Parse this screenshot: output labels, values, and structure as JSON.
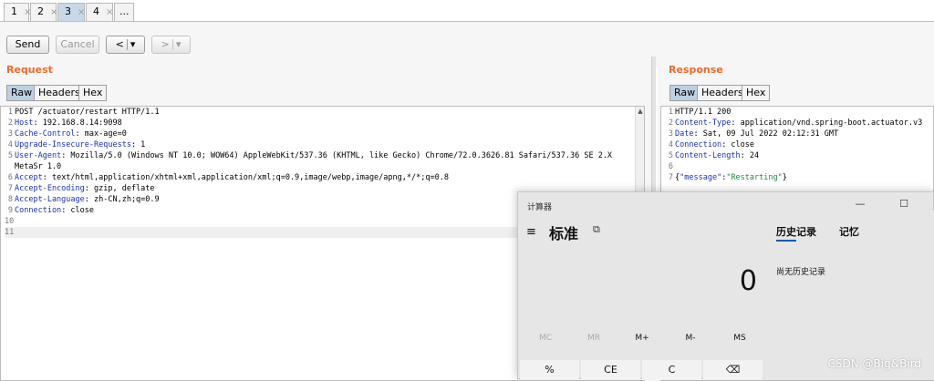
{
  "tabs": [
    {
      "label": "1",
      "close": "×"
    },
    {
      "label": "2",
      "close": "×"
    },
    {
      "label": "3",
      "close": "×"
    },
    {
      "label": "4",
      "close": "×"
    },
    {
      "label": "...",
      "close": ""
    }
  ],
  "toolbar": {
    "send": "Send",
    "cancel": "Cancel",
    "back": "<",
    "back_dd": "▾",
    "forward": ">",
    "forward_dd": "▾"
  },
  "request": {
    "title": "Request",
    "tabs": [
      "Raw",
      "Headers",
      "Hex"
    ],
    "lines": [
      {
        "n": "1",
        "k": "",
        "v": "POST /actuator/restart HTTP/1.1"
      },
      {
        "n": "2",
        "k": "Host",
        "v": ": 192.168.8.14:9098"
      },
      {
        "n": "3",
        "k": "Cache-Control",
        "v": ": max-age=0"
      },
      {
        "n": "4",
        "k": "Upgrade-Insecure-Requests",
        "v": ": 1"
      },
      {
        "n": "5",
        "k": "User-Agent",
        "v": ": Mozilla/5.0 (Windows NT 10.0; WOW64) AppleWebKit/537.36 (KHTML, like Gecko) Chrome/72.0.3626.81 Safari/537.36 SE 2.X"
      },
      {
        "n": "",
        "k": "",
        "v": "MetaSr 1.0"
      },
      {
        "n": "6",
        "k": "Accept",
        "v": ": text/html,application/xhtml+xml,application/xml;q=0.9,image/webp,image/apng,*/*;q=0.8"
      },
      {
        "n": "7",
        "k": "Accept-Encoding",
        "v": ": gzip, deflate"
      },
      {
        "n": "8",
        "k": "Accept-Language",
        "v": ": zh-CN,zh;q=0.9"
      },
      {
        "n": "9",
        "k": "Connection",
        "v": ": close"
      },
      {
        "n": "10",
        "k": "",
        "v": ""
      },
      {
        "n": "11",
        "k": "",
        "v": ""
      }
    ]
  },
  "response": {
    "title": "Response",
    "tabs": [
      "Raw",
      "Headers",
      "Hex"
    ],
    "lines": [
      {
        "n": "1",
        "k": "",
        "v": "HTTP/1.1 200"
      },
      {
        "n": "2",
        "k": "Content-Type",
        "v": ": application/vnd.spring-boot.actuator.v3"
      },
      {
        "n": "3",
        "k": "Date",
        "v": ": Sat, 09 Jul 2022 02:12:31 GMT"
      },
      {
        "n": "4",
        "k": "Connection",
        "v": ": close"
      },
      {
        "n": "5",
        "k": "Content-Length",
        "v": ": 24"
      },
      {
        "n": "6",
        "k": "",
        "v": ""
      },
      {
        "n": "7",
        "k": "",
        "v": ""
      }
    ],
    "json_open": "{",
    "json_key": "\"message\"",
    "json_colon": ":",
    "json_value": "\"Restarting\"",
    "json_close": "}"
  },
  "calculator": {
    "title": "计算器",
    "mode": "标准",
    "display": "0",
    "history_tab": "历史记录",
    "memory_tab": "记忆",
    "history_empty": "尚无历史记录",
    "memory_buttons": [
      "MC",
      "MR",
      "M+",
      "M-",
      "MS"
    ],
    "keys": [
      "%",
      "CE",
      "C",
      "⌫"
    ],
    "minimize": "—",
    "maximize": "☐",
    "menu": "≡",
    "keep_on_top": "⧉"
  },
  "watermark": "CSDN @Big&Bird"
}
